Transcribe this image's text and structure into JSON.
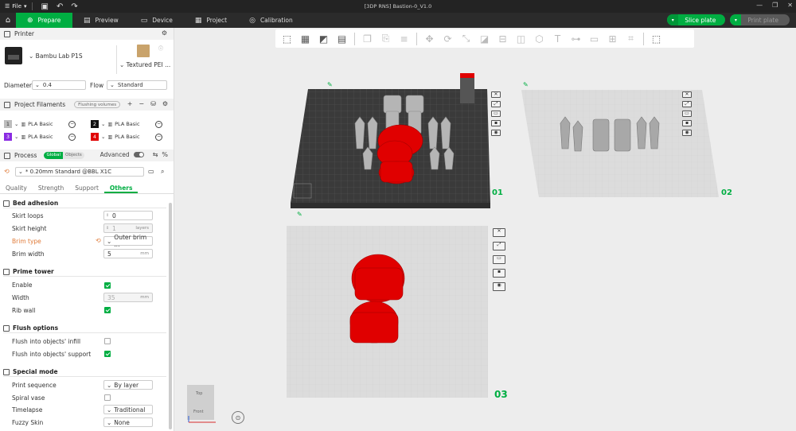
{
  "titlebar": {
    "file_menu": "File",
    "window_title": "[3DP RNS] Bastion-0_V1.0"
  },
  "nav": {
    "tabs": [
      {
        "label": "Prepare",
        "icon": "prepare-icon"
      },
      {
        "label": "Preview",
        "icon": "preview-icon"
      },
      {
        "label": "Device",
        "icon": "device-icon"
      },
      {
        "label": "Project",
        "icon": "project-icon"
      },
      {
        "label": "Calibration",
        "icon": "calibration-icon"
      }
    ],
    "slice_label": "Slice plate",
    "print_label": "Print plate"
  },
  "printer": {
    "section_title": "Printer",
    "printer_name": "Bambu Lab P1S",
    "plate_name": "Textured PEI ...",
    "tiny_label": "Nozzle",
    "diameter_label": "Diameter",
    "diameter_value": "0.4",
    "flow_label": "Flow",
    "flow_value": "Standard"
  },
  "filaments": {
    "section_title": "Project Filaments",
    "flushing_label": "Flushing volumes",
    "items": [
      {
        "num": "1",
        "color": "#bdbdbd",
        "name": "PLA Basic"
      },
      {
        "num": "2",
        "color": "#111111",
        "name": "PLA Basic"
      },
      {
        "num": "3",
        "color": "#8a2be2",
        "name": "PLA Basic"
      },
      {
        "num": "4",
        "color": "#e00000",
        "name": "PLA Basic"
      }
    ]
  },
  "process": {
    "section_title": "Process",
    "global_label": "Global",
    "objects_label": "Objects",
    "advanced_label": "Advanced",
    "preset": "* 0.20mm Standard @BBL X1C",
    "tabs": [
      "Quality",
      "Strength",
      "Support",
      "Others"
    ],
    "active_tab": "Others"
  },
  "settings": {
    "bed_adhesion": {
      "title": "Bed adhesion",
      "skirt_loops_label": "Skirt loops",
      "skirt_loops": "0",
      "skirt_height_label": "Skirt height",
      "skirt_height": "1",
      "skirt_height_unit": "layers",
      "brim_type_label": "Brim type",
      "brim_type": "Outer brim ...",
      "brim_width_label": "Brim width",
      "brim_width": "5",
      "brim_width_unit": "mm"
    },
    "prime_tower": {
      "title": "Prime tower",
      "enable_label": "Enable",
      "width_label": "Width",
      "width": "35",
      "width_unit": "mm",
      "rib_wall_label": "Rib wall"
    },
    "flush_options": {
      "title": "Flush options",
      "infill_label": "Flush into objects' infill",
      "support_label": "Flush into objects' support"
    },
    "special_mode": {
      "title": "Special mode",
      "print_sequence_label": "Print sequence",
      "print_sequence": "By layer",
      "spiral_label": "Spiral vase",
      "timelapse_label": "Timelapse",
      "timelapse": "Traditional",
      "fuzzy_label": "Fuzzy Skin",
      "fuzzy": "None"
    }
  },
  "plates": [
    {
      "number": "01"
    },
    {
      "number": "02"
    },
    {
      "number": "03"
    }
  ],
  "view_cube": {
    "top": "Top",
    "front": "Front"
  },
  "colors": {
    "accent": "#00ae42",
    "model_red": "#e00000",
    "bed_dark": "#3a3a3a"
  }
}
